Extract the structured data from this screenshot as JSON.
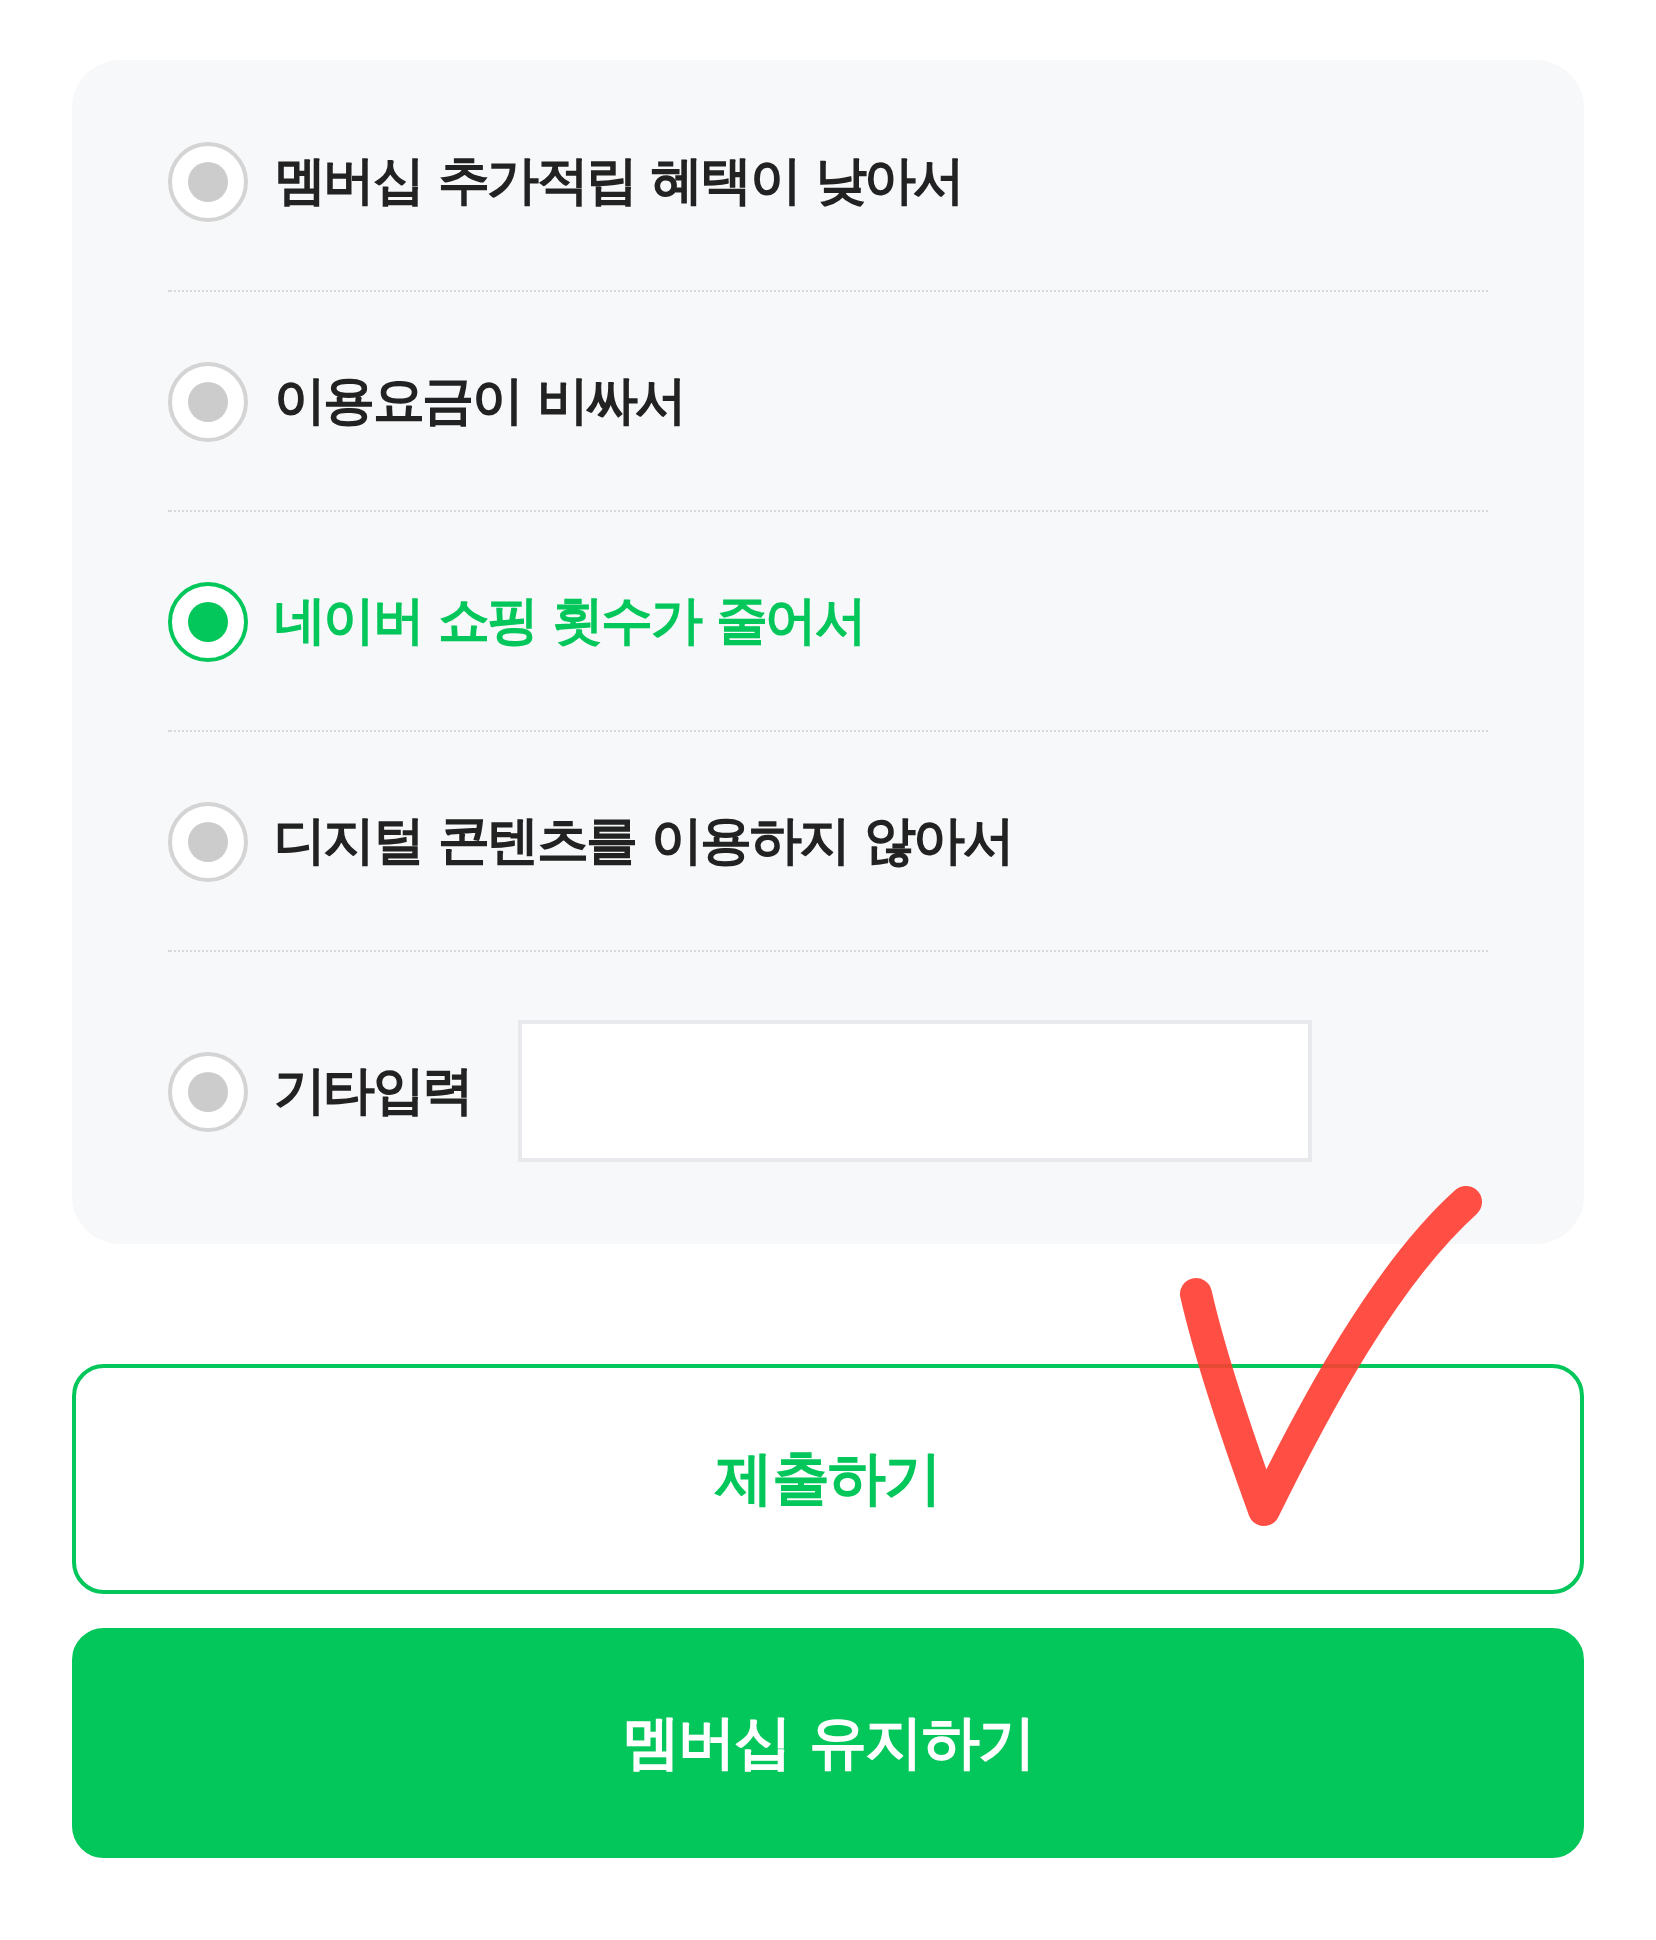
{
  "options": [
    {
      "label": "멤버십 추가적립 혜택이 낮아서",
      "selected": false,
      "kind": "choice"
    },
    {
      "label": "이용요금이 비싸서",
      "selected": false,
      "kind": "choice"
    },
    {
      "label": "네이버 쇼핑 횟수가 줄어서",
      "selected": true,
      "kind": "choice"
    },
    {
      "label": "디지털 콘텐츠를 이용하지 않아서",
      "selected": false,
      "kind": "choice"
    },
    {
      "label": "기타입력",
      "selected": false,
      "kind": "other_input"
    }
  ],
  "buttons": [
    {
      "label": "제출하기",
      "kind": "outline"
    },
    {
      "label": "멤버십 유지하기",
      "kind": "filled"
    }
  ]
}
